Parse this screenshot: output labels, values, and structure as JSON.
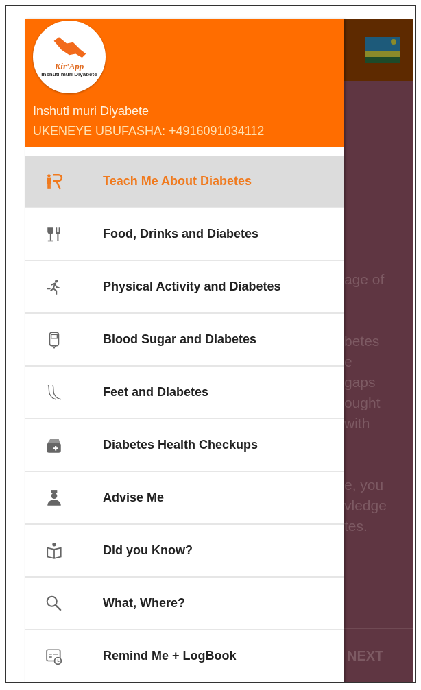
{
  "drawer": {
    "logo": {
      "name": "Kir'App",
      "tagline": "Inshuti muri Diyabete"
    },
    "title": "Inshuti muri Diyabete",
    "subtitle": "UKENEYE UBUFASHA: +4916091034112",
    "items": [
      {
        "label": "Teach Me About Diabetes",
        "selected": true
      },
      {
        "label": "Food, Drinks and Diabetes",
        "selected": false
      },
      {
        "label": "Physical Activity and Diabetes",
        "selected": false
      },
      {
        "label": "Blood Sugar and Diabetes",
        "selected": false
      },
      {
        "label": "Feet and Diabetes",
        "selected": false
      },
      {
        "label": "Diabetes Health Checkups",
        "selected": false
      },
      {
        "label": "Advise Me",
        "selected": false
      },
      {
        "label": "Did you Know?",
        "selected": false
      },
      {
        "label": "What, Where?",
        "selected": false
      },
      {
        "label": "Remind Me + LogBook",
        "selected": false
      }
    ]
  },
  "background": {
    "paragraphs": [
      [
        "age of"
      ],
      [
        "betes",
        "e",
        "gaps",
        "ought",
        "with"
      ],
      [
        "e, you",
        "vledge",
        "tes."
      ]
    ],
    "next_button": "NEXT"
  }
}
